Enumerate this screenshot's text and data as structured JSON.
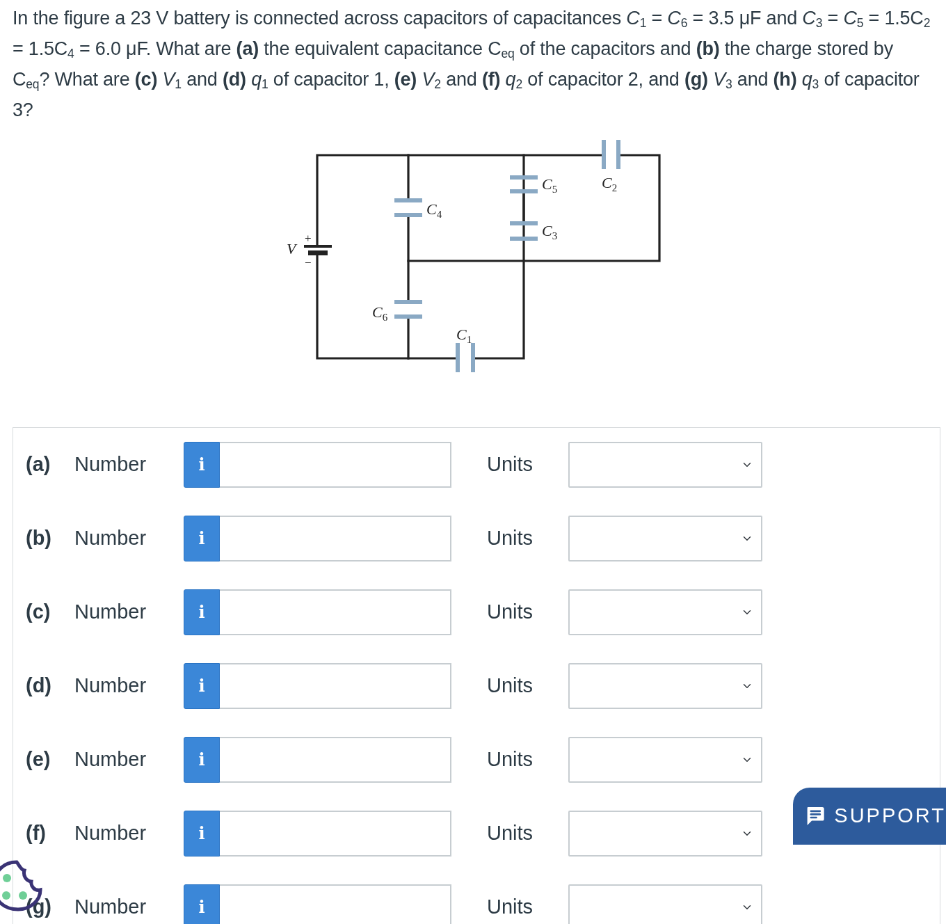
{
  "question": "In the figure a 23 V battery is connected across capacitors of capacitances *C*$_{1}$ = *C*$_{6}$ = 3.5 μF and *C*$_{3}$ = *C*$_{5}$ = 1.5C$_{2}$ = 1.5C$_{4}$ = 6.0 μF. What are **(a)** the equivalent capacitance C$_{eq}$ of the capacitors and **(b)** the charge stored by C$_{eq}$? What are **(c)** *V*$_{1}$ and **(d)** *q*$_{1}$ of capacitor 1, **(e)** *V*$_{2}$ and **(f)** *q*$_{2}$ of capacitor 2, and **(g)** *V*$_{3}$ and **(h)** *q*$_{3}$ of capacitor 3?",
  "figure": {
    "battery": {
      "label": "V",
      "plus": "+",
      "minus": "−"
    },
    "capacitors": [
      {
        "symbol": "C",
        "index": "4"
      },
      {
        "symbol": "C",
        "index": "5"
      },
      {
        "symbol": "C",
        "index": "3"
      },
      {
        "symbol": "C",
        "index": "2"
      },
      {
        "symbol": "C",
        "index": "6"
      },
      {
        "symbol": "C",
        "index": "1"
      }
    ]
  },
  "answers": [
    {
      "part": "(a)",
      "label": "Number",
      "info": "i",
      "units_label": "Units"
    },
    {
      "part": "(b)",
      "label": "Number",
      "info": "i",
      "units_label": "Units"
    },
    {
      "part": "(c)",
      "label": "Number",
      "info": "i",
      "units_label": "Units"
    },
    {
      "part": "(d)",
      "label": "Number",
      "info": "i",
      "units_label": "Units"
    },
    {
      "part": "(e)",
      "label": "Number",
      "info": "i",
      "units_label": "Units"
    },
    {
      "part": "(f)",
      "label": "Number",
      "info": "i",
      "units_label": "Units"
    },
    {
      "part": "(g)",
      "label": "Number",
      "info": "i",
      "units_label": "Units"
    }
  ],
  "support_button": {
    "label": "SUPPORT"
  }
}
